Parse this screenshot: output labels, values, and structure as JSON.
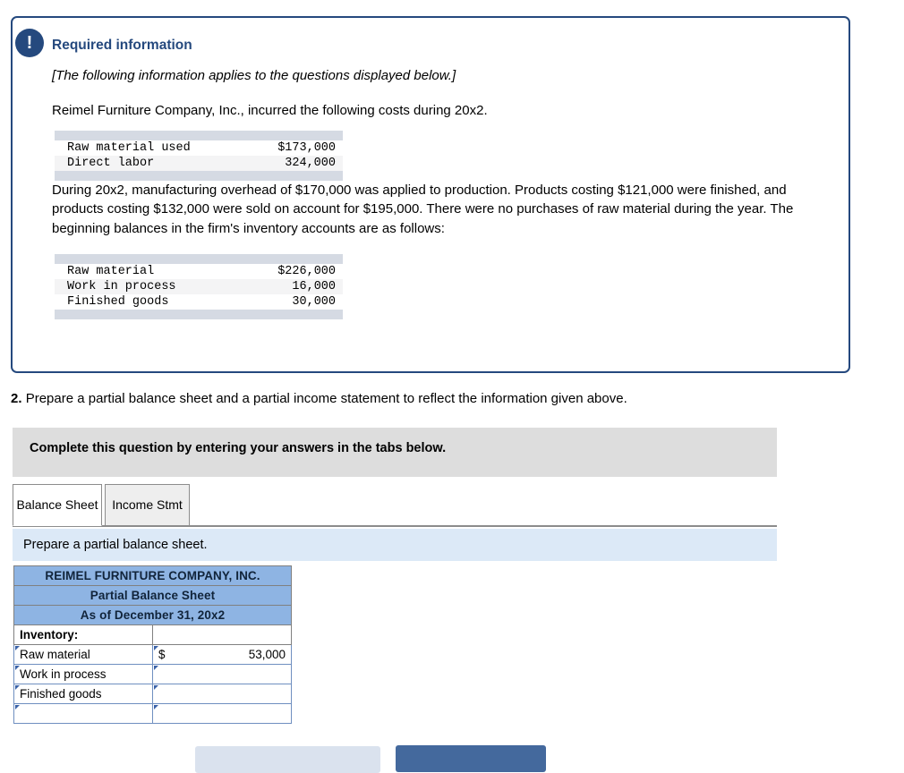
{
  "required_panel": {
    "badge_icon": "exclamation-icon",
    "badge_glyph": "!",
    "heading": "Required information",
    "applies_note": "[The following information applies to the questions displayed below.]",
    "intro": "Reimel Furniture Company, Inc., incurred the following costs during 20x2.",
    "costs_table": {
      "rows": [
        {
          "label": "Raw material used",
          "value": "$173,000"
        },
        {
          "label": "Direct labor",
          "value": "324,000"
        }
      ]
    },
    "middle_paragraph": "During 20x2, manufacturing overhead of $170,000 was applied to production. Products costing $121,000 were finished, and products costing $132,000 were sold on account for $195,000. There were no purchases of raw material during the year. The beginning balances in the firm's inventory accounts are as follows:",
    "balances_table": {
      "rows": [
        {
          "label": "Raw material",
          "value": "$226,000"
        },
        {
          "label": "Work in process",
          "value": "16,000"
        },
        {
          "label": "Finished goods",
          "value": "30,000"
        }
      ]
    }
  },
  "question": {
    "number": "2.",
    "text": "Prepare a partial balance sheet and a partial income statement to reflect the information given above."
  },
  "complete_banner": {
    "text": "Complete this question by entering your answers in the tabs below."
  },
  "tabs": [
    {
      "label": "Balance Sheet",
      "active": true
    },
    {
      "label": "Income Stmt",
      "active": false
    }
  ],
  "instruction": {
    "text": "Prepare a partial balance sheet."
  },
  "worksheet": {
    "title_lines": [
      "REIMEL FURNITURE COMPANY, INC.",
      "Partial Balance Sheet",
      "As of December 31, 20x2"
    ],
    "section_label": "Inventory:",
    "rows": [
      {
        "label": "Raw material",
        "dollar": "$",
        "amount": "53,000"
      },
      {
        "label": "Work in process",
        "dollar": "",
        "amount": ""
      },
      {
        "label": "Finished goods",
        "dollar": "",
        "amount": ""
      },
      {
        "label": "",
        "dollar": "",
        "amount": ""
      }
    ]
  },
  "footer_buttons": [
    {
      "name": "previous-button",
      "label": ""
    },
    {
      "name": "next-button",
      "label": ""
    }
  ],
  "colors": {
    "panel_border": "#25497e",
    "heading_blue": "#25497e",
    "table_band": "#d5dae3",
    "banner_gray": "#dddddd",
    "instruction_blue": "#dce9f7",
    "worksheet_header_blue": "#8eb4e3",
    "primary_button": "#44699d",
    "secondary_button": "#dae2ee"
  }
}
